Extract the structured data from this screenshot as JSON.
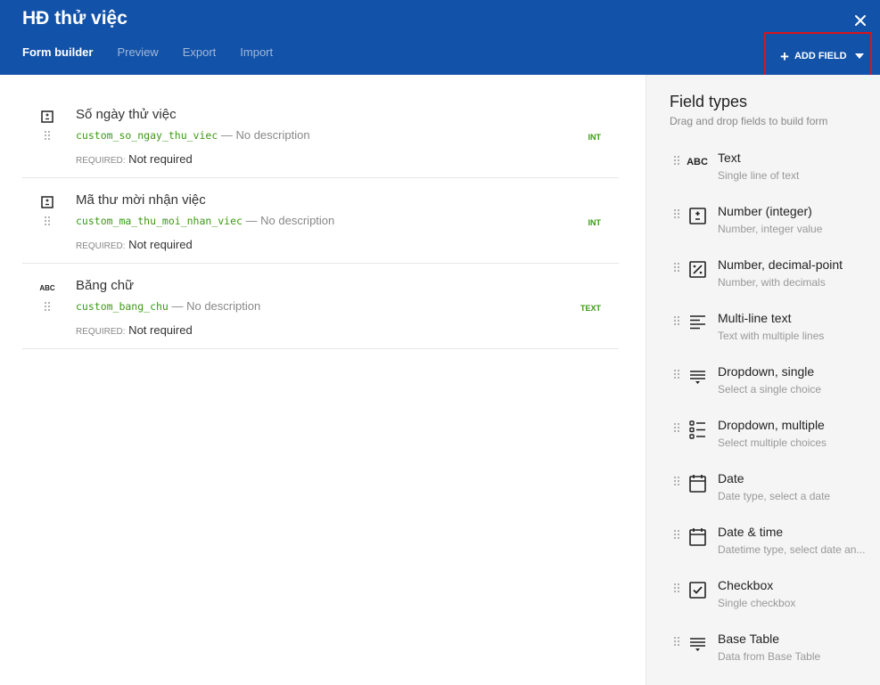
{
  "header": {
    "title": "HĐ thử việc",
    "tabs": [
      {
        "label": "Form builder"
      },
      {
        "label": "Preview"
      },
      {
        "label": "Export"
      },
      {
        "label": "Import"
      }
    ],
    "add_field_label": "ADD FIELD"
  },
  "fields": [
    {
      "title": "Số ngày thử việc",
      "code": "custom_so_ngay_thu_viec",
      "desc": " — No description",
      "req_label": "REQUIRED:",
      "req_value": " Not required",
      "type": "INT"
    },
    {
      "title": "Mã thư mời nhận việc",
      "code": "custom_ma_thu_moi_nhan_viec",
      "desc": " — No description",
      "req_label": "REQUIRED:",
      "req_value": " Not required",
      "type": "INT"
    },
    {
      "title": "Băng chữ",
      "code": "custom_bang_chu",
      "desc": " — No description",
      "req_label": "REQUIRED:",
      "req_value": " Not required",
      "type": "TEXT",
      "icon_text": "ABC"
    }
  ],
  "sidebar": {
    "title": "Field types",
    "subtitle": "Drag and drop fields to build form",
    "items": [
      {
        "name": "Text",
        "desc": "Single line of text",
        "icon": "abc-icon",
        "icon_text": "ABC"
      },
      {
        "name": "Number (integer)",
        "desc": "Number, integer value",
        "icon": "integer-icon"
      },
      {
        "name": "Number, decimal-point",
        "desc": "Number, with decimals",
        "icon": "percent-icon"
      },
      {
        "name": "Multi-line text",
        "desc": "Text with multiple lines",
        "icon": "align-left-icon"
      },
      {
        "name": "Dropdown, single",
        "desc": "Select a single choice",
        "icon": "dropdown-single-icon"
      },
      {
        "name": "Dropdown, multiple",
        "desc": "Select multiple choices",
        "icon": "list-icon"
      },
      {
        "name": "Date",
        "desc": "Date type, select a date",
        "icon": "calendar-icon"
      },
      {
        "name": "Date & time",
        "desc": "Datetime type, select date an...",
        "icon": "calendar-icon"
      },
      {
        "name": "Checkbox",
        "desc": "Single checkbox",
        "icon": "checkbox-icon"
      },
      {
        "name": "Base Table",
        "desc": "Data from Base Table",
        "icon": "table-lines-icon"
      }
    ]
  }
}
